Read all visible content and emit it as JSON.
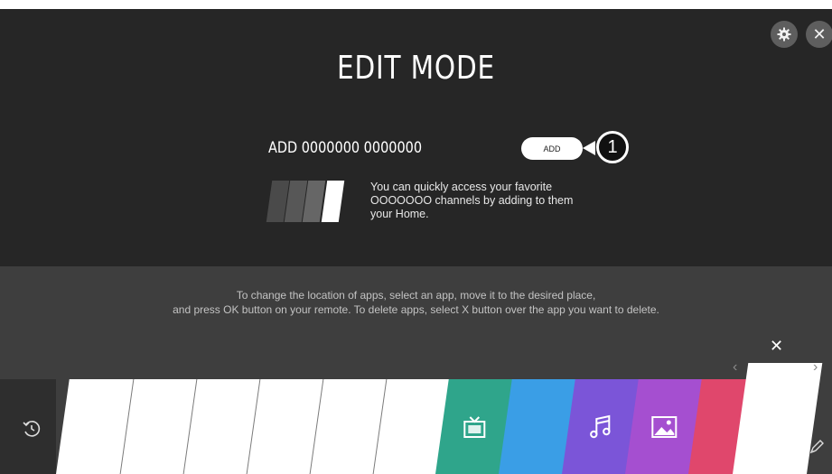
{
  "header": {
    "title": "EDIT MODE",
    "settings_icon": "gear-icon",
    "close_icon": "close-icon",
    "close_glyph": "✕"
  },
  "add_section": {
    "heading": "ADD 0000000 0000000",
    "button_label": "ADD",
    "callout_number": "1",
    "description_lines": [
      "You can quickly access your favorite",
      "OOOOOOO channels by adding to them",
      "your Home."
    ]
  },
  "instructions": {
    "line1": "To change the location of apps, select an app, move it to the desired place,",
    "line2": "and press OK button on your remote. To delete apps, select X button over the app you want to delete."
  },
  "launcher": {
    "selected_close_glyph": "✕",
    "prev_glyph": "‹",
    "next_glyph": "›",
    "history_icon": "history-icon",
    "edit_icon": "pencil-icon",
    "apps": [
      {
        "name": "blank-app",
        "color": "#ffffff",
        "icon": ""
      },
      {
        "name": "blank-app",
        "color": "#ffffff",
        "icon": ""
      },
      {
        "name": "blank-app",
        "color": "#ffffff",
        "icon": ""
      },
      {
        "name": "blank-app",
        "color": "#ffffff",
        "icon": ""
      },
      {
        "name": "blank-app",
        "color": "#ffffff",
        "icon": ""
      },
      {
        "name": "blank-app",
        "color": "#ffffff",
        "icon": ""
      },
      {
        "name": "tv-app",
        "color": "#2fa58b",
        "icon": "tv-icon"
      },
      {
        "name": "blue-app",
        "color": "#3a9ee6",
        "icon": ""
      },
      {
        "name": "music-app",
        "color": "#7b55d8",
        "icon": "music-note-icon"
      },
      {
        "name": "photo-app",
        "color": "#a54fd0",
        "icon": "image-icon"
      },
      {
        "name": "red-app",
        "color": "#e0476c",
        "icon": ""
      }
    ]
  },
  "colors": {
    "upper_bg": "#262626",
    "lower_bg": "#3e3e3e",
    "accent_white": "#ffffff"
  }
}
